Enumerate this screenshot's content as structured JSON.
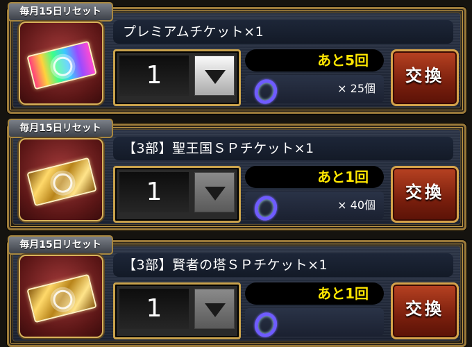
{
  "cards": [
    {
      "badge": "毎月15日リセット",
      "ticket_style": "rainbow",
      "title": "プレミアムチケット×1",
      "quantity": "1",
      "quantity_button_enabled": true,
      "remaining": "あと5回",
      "cost": "× 25個",
      "cost_icon": "ring-icon",
      "exchange_label": "交換"
    },
    {
      "badge": "毎月15日リセット",
      "ticket_style": "gold",
      "title": "【3部】聖王国ＳＰチケット×1",
      "quantity": "1",
      "quantity_button_enabled": false,
      "remaining": "あと1回",
      "cost": "× 40個",
      "cost_icon": "ring-icon",
      "exchange_label": "交換"
    },
    {
      "badge": "毎月15日リセット",
      "ticket_style": "gold",
      "title": "【3部】賢者の塔ＳＰチケット×1",
      "quantity": "1",
      "quantity_button_enabled": false,
      "remaining": "あと1回",
      "cost": "",
      "cost_icon": "ring-icon",
      "exchange_label": "交換"
    }
  ],
  "colors": {
    "remaining_text": "#ffe600",
    "exchange_button": "#7a1f0d",
    "frame_gold": "#c9a24c"
  }
}
